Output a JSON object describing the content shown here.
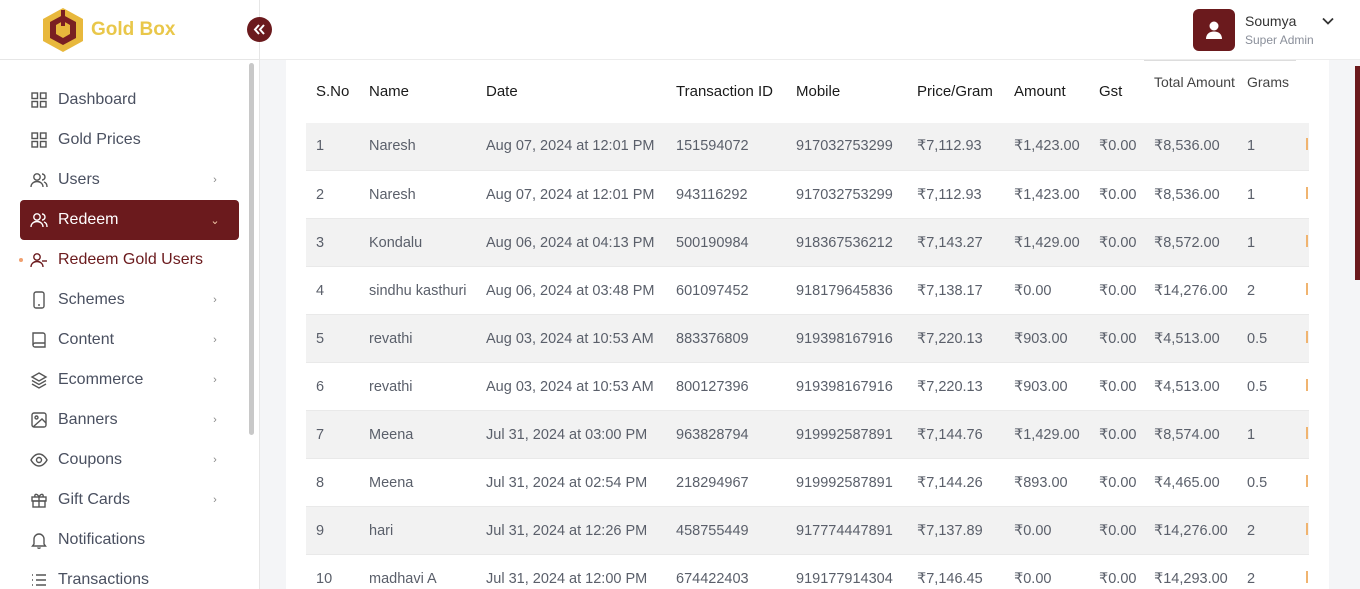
{
  "brand": {
    "name": "Gold Box"
  },
  "sidebar": {
    "items": [
      {
        "label": "Dashboard",
        "icon": "grid-icon",
        "chevron": false
      },
      {
        "label": "Gold Prices",
        "icon": "grid-icon",
        "chevron": false
      },
      {
        "label": "Users",
        "icon": "users-icon",
        "chevron": true
      },
      {
        "label": "Redeem",
        "icon": "users-icon",
        "chevron": true,
        "active": true
      },
      {
        "label": "Redeem Gold Users",
        "icon": "user-minus-icon",
        "sub": true
      },
      {
        "label": "Schemes",
        "icon": "phone-icon",
        "chevron": true
      },
      {
        "label": "Content",
        "icon": "book-icon",
        "chevron": true
      },
      {
        "label": "Ecommerce",
        "icon": "layers-icon",
        "chevron": true
      },
      {
        "label": "Banners",
        "icon": "image-icon",
        "chevron": true
      },
      {
        "label": "Coupons",
        "icon": "eye-icon",
        "chevron": true
      },
      {
        "label": "Gift Cards",
        "icon": "gift-icon",
        "chevron": true
      },
      {
        "label": "Notifications",
        "icon": "bell-icon",
        "chevron": false
      },
      {
        "label": "Transactions",
        "icon": "list-icon",
        "chevron": false
      }
    ]
  },
  "user": {
    "name": "Soumya",
    "role": "Super Admin"
  },
  "table": {
    "headers": [
      "S.No",
      "Name",
      "Date",
      "Transaction ID",
      "Mobile",
      "Price/Gram",
      "Amount",
      "Gst",
      "Total Amount",
      "Grams"
    ],
    "rows": [
      [
        "1",
        "Naresh",
        "Aug 07, 2024 at 12:01 PM",
        "151594072",
        "917032753299",
        "₹7,112.93",
        "₹1,423.00",
        "₹0.00",
        "₹8,536.00",
        "1"
      ],
      [
        "2",
        "Naresh",
        "Aug 07, 2024 at 12:01 PM",
        "943116292",
        "917032753299",
        "₹7,112.93",
        "₹1,423.00",
        "₹0.00",
        "₹8,536.00",
        "1"
      ],
      [
        "3",
        "Kondalu",
        "Aug 06, 2024 at 04:13 PM",
        "500190984",
        "918367536212",
        "₹7,143.27",
        "₹1,429.00",
        "₹0.00",
        "₹8,572.00",
        "1"
      ],
      [
        "4",
        "sindhu kasthuri",
        "Aug 06, 2024 at 03:48 PM",
        "601097452",
        "918179645836",
        "₹7,138.17",
        "₹0.00",
        "₹0.00",
        "₹14,276.00",
        "2"
      ],
      [
        "5",
        "revathi",
        "Aug 03, 2024 at 10:53 AM",
        "883376809",
        "919398167916",
        "₹7,220.13",
        "₹903.00",
        "₹0.00",
        "₹4,513.00",
        "0.5"
      ],
      [
        "6",
        "revathi",
        "Aug 03, 2024 at 10:53 AM",
        "800127396",
        "919398167916",
        "₹7,220.13",
        "₹903.00",
        "₹0.00",
        "₹4,513.00",
        "0.5"
      ],
      [
        "7",
        "Meena",
        "Jul 31, 2024 at 03:00 PM",
        "963828794",
        "919992587891",
        "₹7,144.76",
        "₹1,429.00",
        "₹0.00",
        "₹8,574.00",
        "1"
      ],
      [
        "8",
        "Meena",
        "Jul 31, 2024 at 02:54 PM",
        "218294967",
        "919992587891",
        "₹7,144.26",
        "₹893.00",
        "₹0.00",
        "₹4,465.00",
        "0.5"
      ],
      [
        "9",
        "hari",
        "Jul 31, 2024 at 12:26 PM",
        "458755449",
        "917774447891",
        "₹7,137.89",
        "₹0.00",
        "₹0.00",
        "₹14,276.00",
        "2"
      ],
      [
        "10",
        "madhavi A",
        "Jul 31, 2024 at 12:00 PM",
        "674422403",
        "919177914304",
        "₹7,146.45",
        "₹0.00",
        "₹0.00",
        "₹14,293.00",
        "2"
      ]
    ]
  },
  "colors": {
    "brand_maroon": "#6b1a1d",
    "brand_gold": "#e9c74a",
    "row_stripe": "#f2f2f2",
    "accent_orange": "#f0b470"
  }
}
